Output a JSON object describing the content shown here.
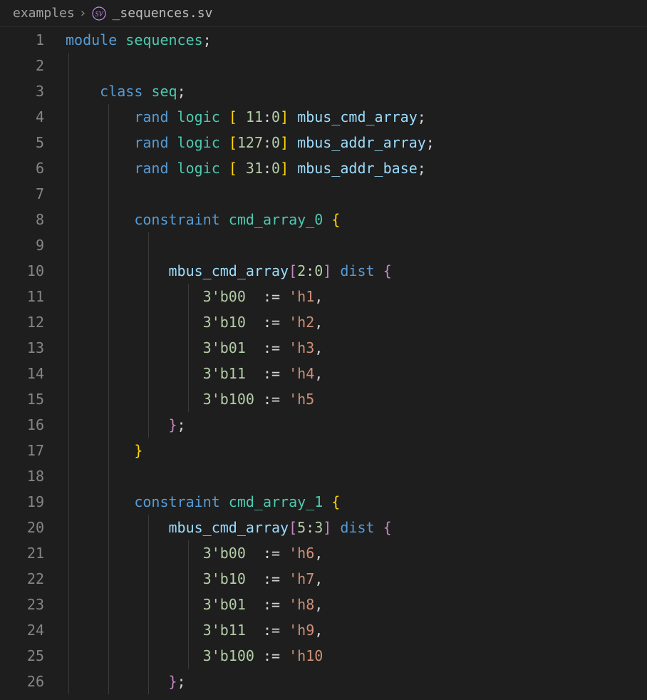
{
  "breadcrumb": {
    "folder": "examples",
    "separator": "›",
    "filename": "_sequences.sv"
  },
  "editor": {
    "first_line_no": 1,
    "last_line_no": 26
  },
  "code": {
    "module_kw": "module",
    "module_name": "sequences",
    "class_kw": "class",
    "class_name": "seq",
    "rand_kw": "rand",
    "logic_kw": "logic",
    "fields": [
      {
        "range": "[ 11:0]",
        "name": "mbus_cmd_array"
      },
      {
        "range": "[127:0]",
        "name": "mbus_addr_array"
      },
      {
        "range": "[ 31:0]",
        "name": "mbus_addr_base"
      }
    ],
    "constraint_kw": "constraint",
    "dist_kw": "dist",
    "constraints": [
      {
        "name": "cmd_array_0",
        "subject": "mbus_cmd_array",
        "slice": "[2:0]",
        "entries": [
          {
            "lhs": "3'b00",
            "pad": "  ",
            "rhs": "'h1"
          },
          {
            "lhs": "3'b10",
            "pad": "  ",
            "rhs": "'h2"
          },
          {
            "lhs": "3'b01",
            "pad": "  ",
            "rhs": "'h3"
          },
          {
            "lhs": "3'b11",
            "pad": "  ",
            "rhs": "'h4"
          },
          {
            "lhs": "3'b100",
            "pad": " ",
            "rhs": "'h5"
          }
        ]
      },
      {
        "name": "cmd_array_1",
        "subject": "mbus_cmd_array",
        "slice": "[5:3]",
        "entries": [
          {
            "lhs": "3'b00",
            "pad": "  ",
            "rhs": "'h6"
          },
          {
            "lhs": "3'b10",
            "pad": "  ",
            "rhs": "'h7"
          },
          {
            "lhs": "3'b01",
            "pad": "  ",
            "rhs": "'h8"
          },
          {
            "lhs": "3'b11",
            "pad": "  ",
            "rhs": "'h9"
          },
          {
            "lhs": "3'b100",
            "pad": " ",
            "rhs": "'h10"
          }
        ]
      }
    ],
    "assign_op": ":="
  }
}
